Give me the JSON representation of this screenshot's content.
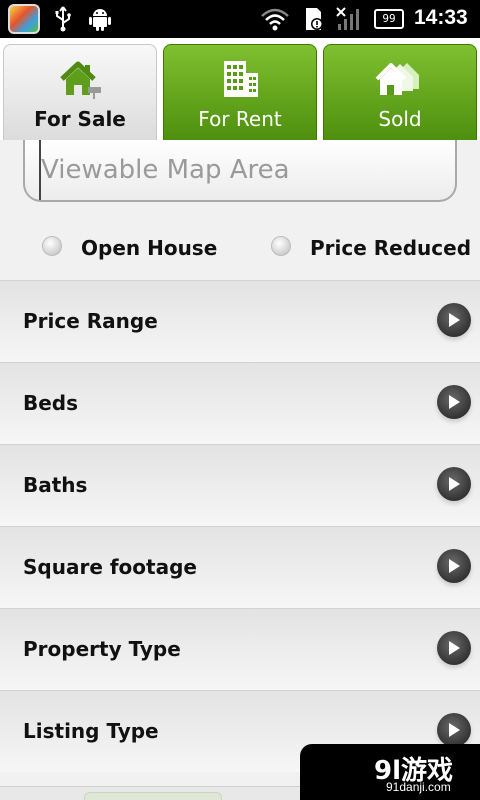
{
  "status_bar": {
    "time": "14:33",
    "battery": "99",
    "icons": [
      "app-icon",
      "usb-icon",
      "android-icon",
      "wifi-icon",
      "sd-card-alert-icon",
      "signal-icon",
      "battery-icon"
    ]
  },
  "tabs": [
    {
      "label": "For Sale",
      "icon": "house-icon",
      "active": true
    },
    {
      "label": "For Rent",
      "icon": "building-icon",
      "active": false
    },
    {
      "label": "Sold",
      "icon": "houses-icon",
      "active": false
    }
  ],
  "colors": {
    "tab_green": "#5fa11a",
    "tab_active": "#e6e6e6",
    "background": "#f1f1f1"
  },
  "search": {
    "placeholder": "Viewable Map Area"
  },
  "options": {
    "open_house": "Open House",
    "price_reduced": "Price Reduced"
  },
  "filters": [
    {
      "label": "Price Range"
    },
    {
      "label": "Beds"
    },
    {
      "label": "Baths"
    },
    {
      "label": "Square footage"
    },
    {
      "label": "Property Type"
    },
    {
      "label": "Listing Type"
    }
  ],
  "watermark": {
    "logo": "9l游戏",
    "site": "91danji.com"
  }
}
